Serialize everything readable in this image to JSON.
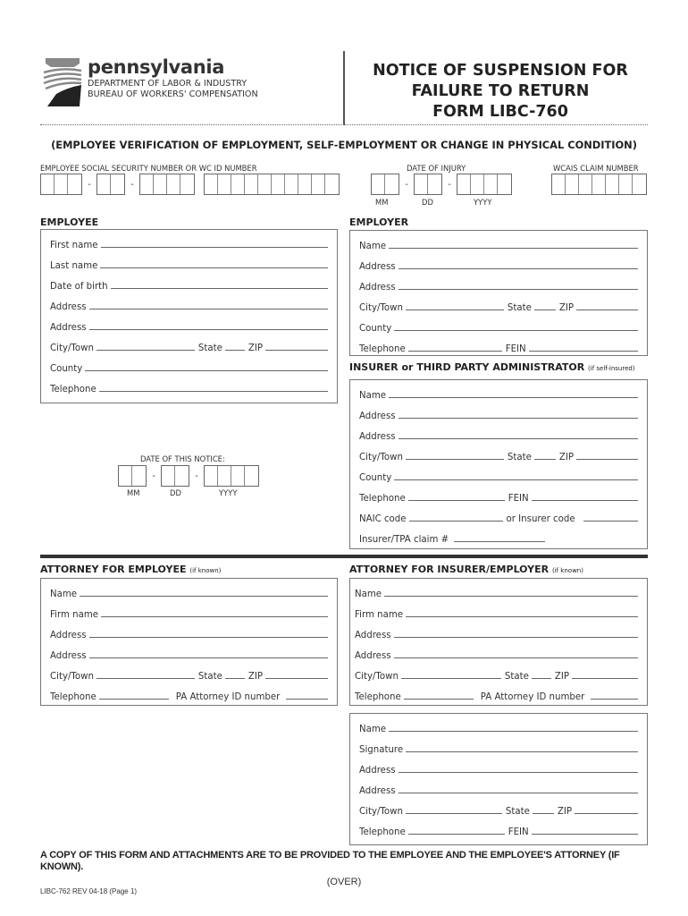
{
  "header": {
    "brand": "pennsylvania",
    "department": "DEPARTMENT OF LABOR & INDUSTRY",
    "bureau": "BUREAU OF WORKERS' COMPENSATION",
    "title_lines": [
      "NOTICE OF SUSPENSION FOR",
      "FAILURE TO RETURN",
      "FORM LIBC-760"
    ],
    "subtitle": "(EMPLOYEE VERIFICATION OF EMPLOYMENT, SELF-EMPLOYMENT OR CHANGE IN PHYSICAL CONDITION)",
    "logo_icon": "keystone-icon"
  },
  "ids": {
    "ssn_label": "EMPLOYEE SOCIAL SECURITY NUMBER  OR  WC ID NUMBER",
    "injury_label": "DATE OF INJURY",
    "wcais_label": "WCAIS CLAIM NUMBER",
    "dash": "-",
    "mm": "MM",
    "dd": "DD",
    "yyyy": "YYYY"
  },
  "employee": {
    "heading": "EMPLOYEE",
    "first_name": "First name",
    "last_name": "Last name",
    "dob": "Date of birth",
    "address": "Address",
    "city": "City/Town",
    "state": "State",
    "zip": "ZIP",
    "county": "County",
    "telephone": "Telephone"
  },
  "notice_date": {
    "label": "DATE OF THIS NOTICE:",
    "mm": "MM",
    "dd": "DD",
    "yyyy": "YYYY",
    "dash": "-"
  },
  "employer": {
    "heading": "EMPLOYER",
    "name": "Name",
    "address": "Address",
    "city": "City/Town",
    "state": "State",
    "zip": "ZIP",
    "county": "County",
    "telephone": "Telephone",
    "fein": "FEIN"
  },
  "insurer": {
    "heading": "INSURER or THIRD PARTY ADMINISTRATOR",
    "heading_note": "(if self-insured)",
    "name": "Name",
    "address": "Address",
    "city": "City/Town",
    "state": "State",
    "zip": "ZIP",
    "county": "County",
    "telephone": "Telephone",
    "fein": "FEIN",
    "naic": "NAIC code",
    "insurer_code": "or Insurer code",
    "claim": "Insurer/TPA claim #"
  },
  "attorney_employee": {
    "heading": "ATTORNEY FOR EMPLOYEE",
    "heading_note": "(if known)",
    "name": "Name",
    "firm": "Firm name",
    "address": "Address",
    "city": "City/Town",
    "state": "State",
    "zip": "ZIP",
    "telephone": "Telephone",
    "pa_id": "PA Attorney ID number"
  },
  "attorney_insurer": {
    "heading": "ATTORNEY FOR INSURER/EMPLOYER",
    "heading_note": "(if known)",
    "name": "Name",
    "firm": "Firm name",
    "address": "Address",
    "city": "City/Town",
    "state": "State",
    "zip": "ZIP",
    "telephone": "Telephone",
    "pa_id": "PA Attorney ID number"
  },
  "signer": {
    "name": "Name",
    "signature": "Signature",
    "address": "Address",
    "city": "City/Town",
    "state": "State",
    "zip": "ZIP",
    "telephone": "Telephone",
    "fein": "FEIN"
  },
  "footer": {
    "note": "A COPY OF THIS FORM AND ATTACHMENTS ARE TO BE PROVIDED TO THE EMPLOYEE AND THE EMPLOYEE'S ATTORNEY (IF KNOWN).",
    "over": "(OVER)",
    "form_number": "LIBC-762 REV 04-18 (Page 1)"
  }
}
